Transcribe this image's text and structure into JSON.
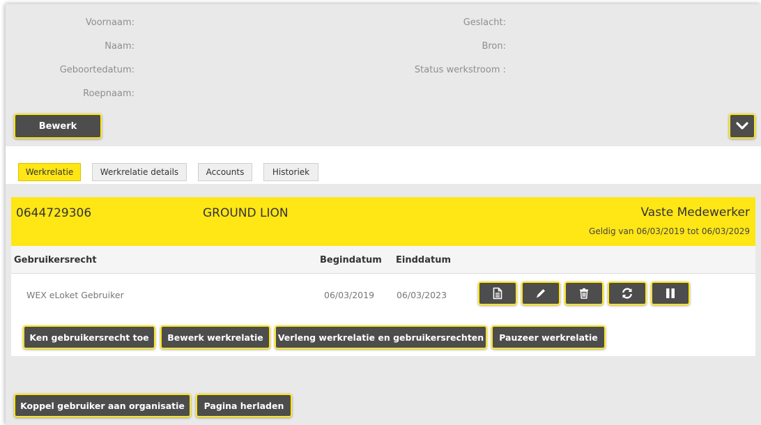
{
  "person": {
    "fields_left": [
      {
        "label": "Voornaam:"
      },
      {
        "label": "Naam:"
      },
      {
        "label": "Geboortedatum:"
      },
      {
        "label": "Roepnaam:"
      }
    ],
    "fields_right": [
      {
        "label": "Geslacht:"
      },
      {
        "label": "Bron:"
      },
      {
        "label": "Status werkstroom :"
      }
    ],
    "edit_label": "Bewerk"
  },
  "tabs": [
    {
      "label": "Werkrelatie",
      "active": true
    },
    {
      "label": "Werkrelatie details",
      "active": false
    },
    {
      "label": "Accounts",
      "active": false
    },
    {
      "label": "Historiek",
      "active": false
    }
  ],
  "relation": {
    "number": "0644729306",
    "organisation": "GROUND LION",
    "type": "Vaste Medewerker",
    "validity": "Geldig van 06/03/2019 tot 06/03/2029"
  },
  "rights_table": {
    "headers": {
      "right": "Gebruikersrecht",
      "start": "Begindatum",
      "end": "Einddatum"
    },
    "rows": [
      {
        "right": "WEX eLoket Gebruiker",
        "start": "06/03/2019",
        "end": "06/03/2023"
      }
    ]
  },
  "row_actions": [
    "document-icon",
    "pencil-icon",
    "trash-icon",
    "refresh-icon",
    "pause-icon"
  ],
  "actions": {
    "grant": "Ken gebruikersrecht toe",
    "edit_relation": "Bewerk werkrelatie",
    "extend": "Verleng werkrelatie en gebruikersrechten",
    "pause": "Pauzeer werkrelatie"
  },
  "footer": {
    "link_org": "Koppel gebruiker aan organisatie",
    "reload": "Pagina herladen"
  },
  "colors": {
    "accent": "#ffe615",
    "button": "#4d4d4d",
    "panel": "#e9e9e9"
  }
}
